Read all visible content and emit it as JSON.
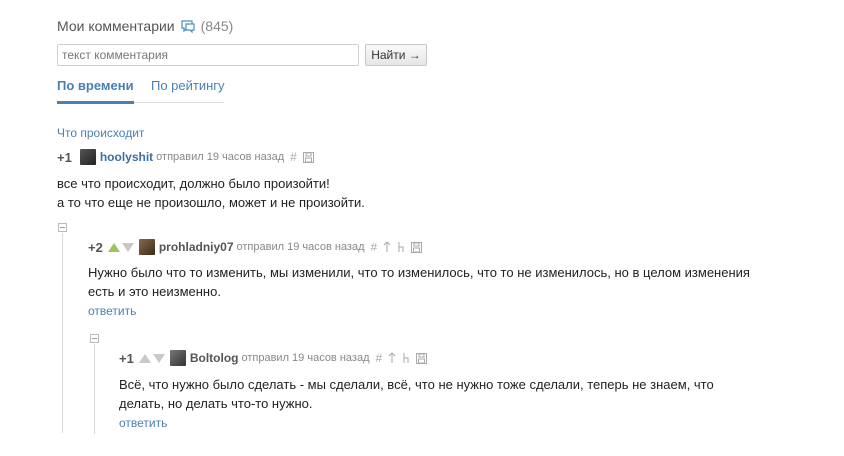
{
  "header": {
    "title": "Мои комментарии",
    "count": "(845)"
  },
  "search": {
    "placeholder": "текст комментария",
    "button_label": "Найти →"
  },
  "tabs": [
    {
      "label": "По времени",
      "active": true
    },
    {
      "label": "По рейтингу",
      "active": false
    }
  ],
  "post": {
    "title": "Что происходит"
  },
  "comments": [
    {
      "rating": "+1",
      "author": "hoolyshit",
      "meta": "отправил 19 часов назад",
      "lines": [
        "все что происходит, должно было произойти!",
        "а то что еще не произошло, может и не произойти."
      ]
    },
    {
      "rating": "+2",
      "author": "prohladniy07",
      "meta": "отправил 19 часов назад",
      "lines": [
        "Нужно было что то изменить, мы изменили, что то изменилось, что то не изменилось, но в целом изменения",
        "есть и это неизменно."
      ],
      "reply": "ответить"
    },
    {
      "rating": "+1",
      "author": "Boltolog",
      "meta": "отправил 19 часов назад",
      "lines": [
        "Всё, что нужно было сделать - мы сделали, всё, что не нужно тоже сделали, теперь не знаем, что",
        "делать, но делать что-то нужно."
      ],
      "reply": "ответить"
    }
  ],
  "colors": {
    "link": "#4a7fb5",
    "upvote": "#9cc45b"
  }
}
